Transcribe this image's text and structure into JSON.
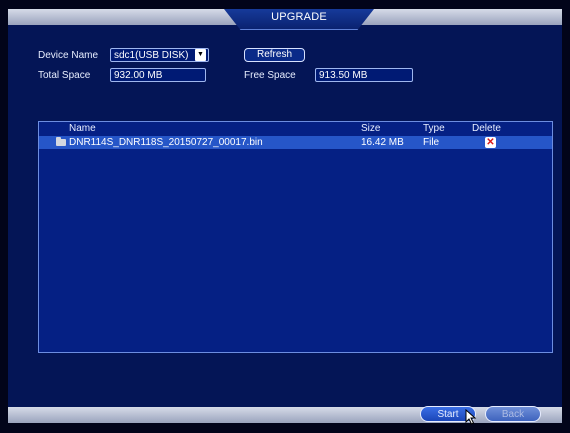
{
  "window": {
    "title": "UPGRADE"
  },
  "device": {
    "name_label": "Device Name",
    "name_value": "sdc1(USB DISK)",
    "refresh_label": "Refresh",
    "total_label": "Total Space",
    "total_value": "932.00 MB",
    "free_label": "Free Space",
    "free_value": "913.50 MB"
  },
  "table": {
    "headers": {
      "name": "Name",
      "size": "Size",
      "type": "Type",
      "delete": "Delete"
    },
    "rows": [
      {
        "name": "DNR114S_DNR118S_20150727_00017.bin",
        "size": "16.42 MB",
        "type": "File",
        "delete_icon": "delete-x-icon"
      }
    ]
  },
  "footer": {
    "start_label": "Start",
    "back_label": "Back"
  },
  "colors": {
    "background": "#041556",
    "selected_row": "#2656c8",
    "delete_icon": "#d81818"
  }
}
